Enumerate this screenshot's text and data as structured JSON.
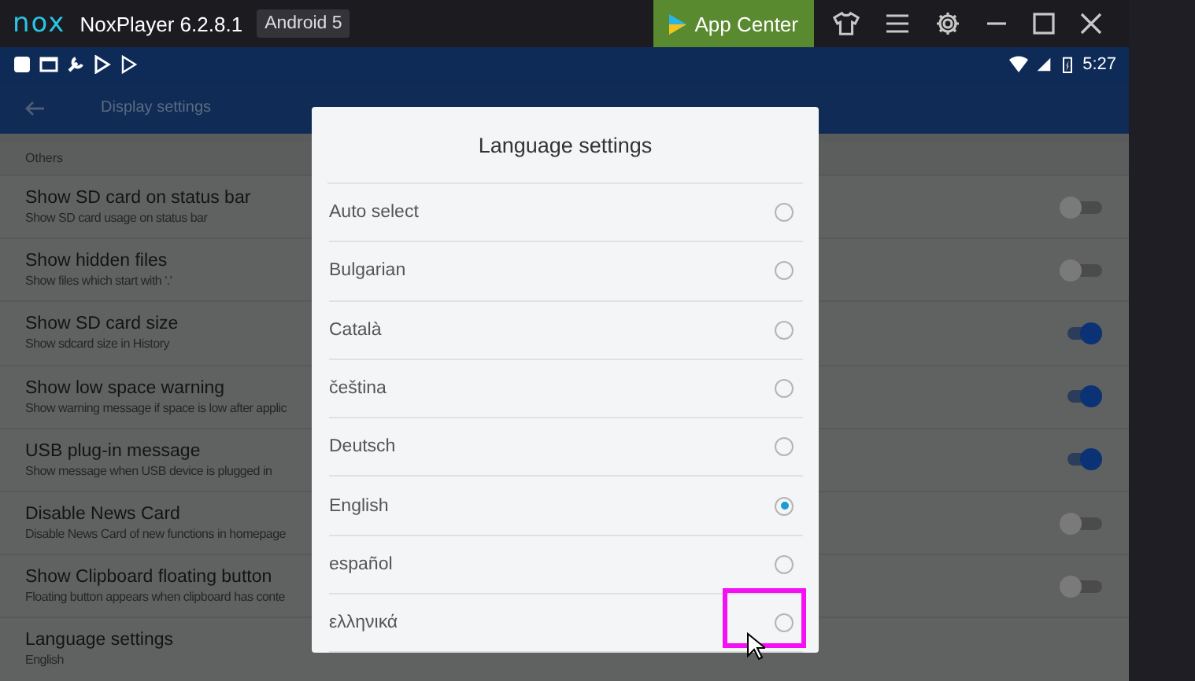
{
  "titlebar": {
    "logo": "nox",
    "title": "NoxPlayer 6.2.8.1",
    "badge": "Android 5",
    "app_center": "App Center"
  },
  "status_bar": {
    "time": "5:27"
  },
  "toolbar": {
    "title": "Display settings"
  },
  "settings": {
    "section": "Others",
    "rows": [
      {
        "kind": "toggle",
        "title": "Show SD card on status bar",
        "subtitle": "Show SD card usage on status bar",
        "on": false
      },
      {
        "kind": "toggle",
        "title": "Show hidden files",
        "subtitle": "Show files which start with '.'",
        "on": false
      },
      {
        "kind": "toggle",
        "title": "Show SD card size",
        "subtitle": "Show sdcard size in History",
        "on": true
      },
      {
        "kind": "toggle",
        "title": "Show low space warning",
        "subtitle": "Show warning message if space is low after applic",
        "on": true
      },
      {
        "kind": "toggle",
        "title": "USB plug-in message",
        "subtitle": "Show message when USB device is plugged in",
        "on": true
      },
      {
        "kind": "toggle",
        "title": "Disable News Card",
        "subtitle": "Disable News Card of new functions in homepage",
        "on": false
      },
      {
        "kind": "toggle",
        "title": "Show Clipboard floating button",
        "subtitle": "Floating button appears when clipboard has conte",
        "on": false
      },
      {
        "kind": "value",
        "title": "Language settings",
        "subtitle": "English"
      }
    ]
  },
  "dialog": {
    "title": "Language settings",
    "options": [
      {
        "label": "Auto select",
        "selected": false
      },
      {
        "label": "Bulgarian",
        "selected": false
      },
      {
        "label": "Català",
        "selected": false
      },
      {
        "label": "čeština",
        "selected": false
      },
      {
        "label": "Deutsch",
        "selected": false
      },
      {
        "label": "English",
        "selected": true
      },
      {
        "label": "español",
        "selected": false
      },
      {
        "label": "ελληνικά",
        "selected": false
      }
    ]
  }
}
